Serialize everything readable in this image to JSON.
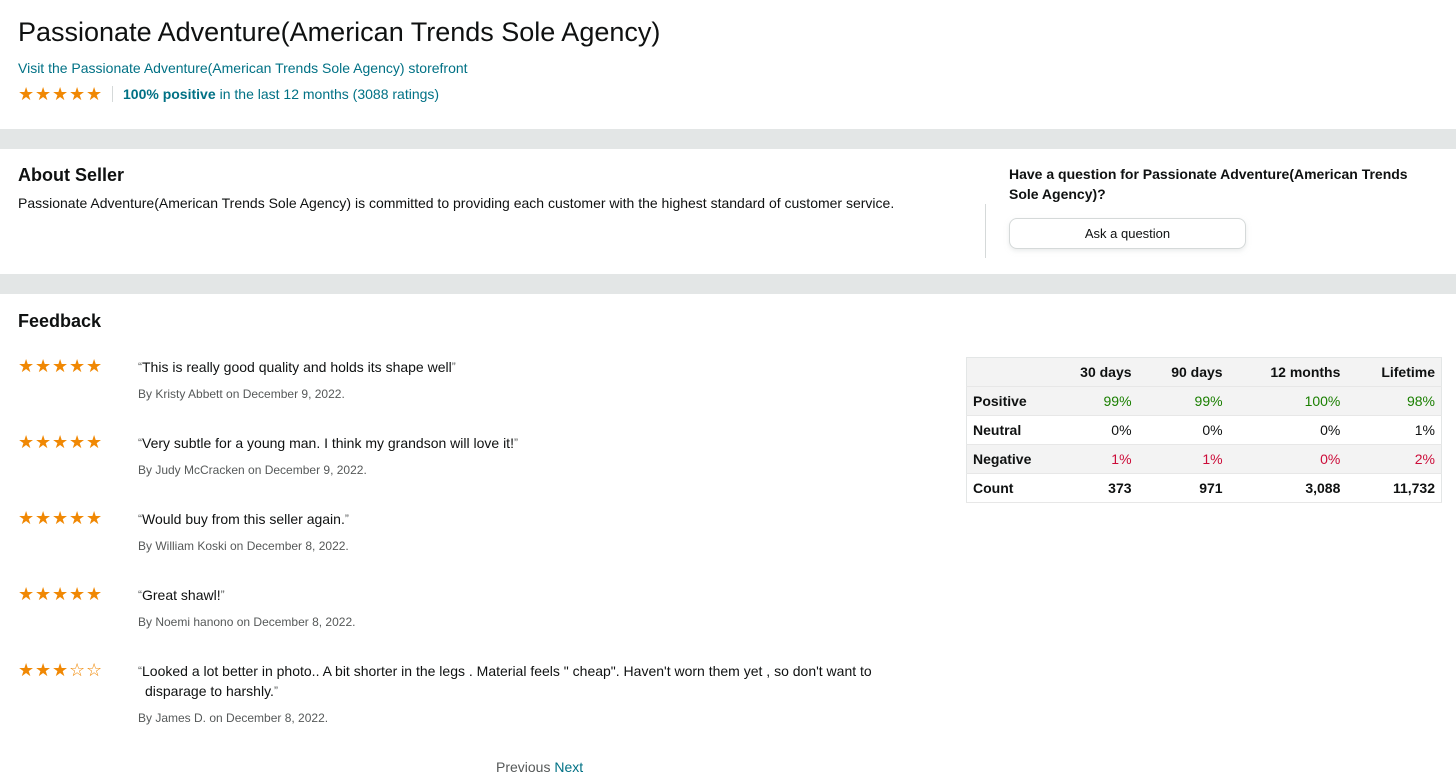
{
  "header": {
    "title": "Passionate Adventure(American Trends Sole Agency)",
    "storefront_link": "Visit the Passionate Adventure(American Trends Sole Agency) storefront",
    "rating_stars": 5,
    "positive_pct": "100% positive",
    "rating_summary": "in the last 12 months (3088 ratings)"
  },
  "about": {
    "heading": "About Seller",
    "text": "Passionate Adventure(American Trends Sole Agency) is committed to providing each customer with the highest standard of customer service."
  },
  "question": {
    "text": "Have a question for Passionate Adventure(American Trends Sole Agency)?",
    "button_label": "Ask a question"
  },
  "feedback": {
    "heading": "Feedback",
    "reviews": [
      {
        "stars": 5,
        "text": "This is really good quality and holds its shape well",
        "by": "By Kristy Abbett on December 9, 2022."
      },
      {
        "stars": 5,
        "text": "Very subtle for a young man. I think my grandson will love it!",
        "by": "By Judy McCracken on December 9, 2022."
      },
      {
        "stars": 5,
        "text": "Would buy from this seller again.",
        "by": "By William Koski on December 8, 2022."
      },
      {
        "stars": 5,
        "text": "Great shawl!",
        "by": "By Noemi hanono on December 8, 2022."
      },
      {
        "stars": 3,
        "text": "Looked a lot better in photo.. A bit shorter in the legs . Material feels \" cheap\". Haven't worn them yet , so don't want to disparage to harshly.",
        "by": "By James D. on December 8, 2022."
      }
    ],
    "pager": {
      "previous": "Previous",
      "next": "Next"
    }
  },
  "stats_table": {
    "columns": [
      "30 days",
      "90 days",
      "12 months",
      "Lifetime"
    ],
    "rows": [
      {
        "label": "Positive",
        "values": [
          "99%",
          "99%",
          "100%",
          "98%"
        ]
      },
      {
        "label": "Neutral",
        "values": [
          "0%",
          "0%",
          "0%",
          "1%"
        ]
      },
      {
        "label": "Negative",
        "values": [
          "1%",
          "1%",
          "0%",
          "2%"
        ]
      },
      {
        "label": "Count",
        "values": [
          "373",
          "971",
          "3,088",
          "11,732"
        ]
      }
    ]
  },
  "colors": {
    "link": "#007185",
    "star": "#f08804",
    "positive": "#1a7f00",
    "negative": "#cc0c39",
    "band": "#e3e6e6"
  }
}
